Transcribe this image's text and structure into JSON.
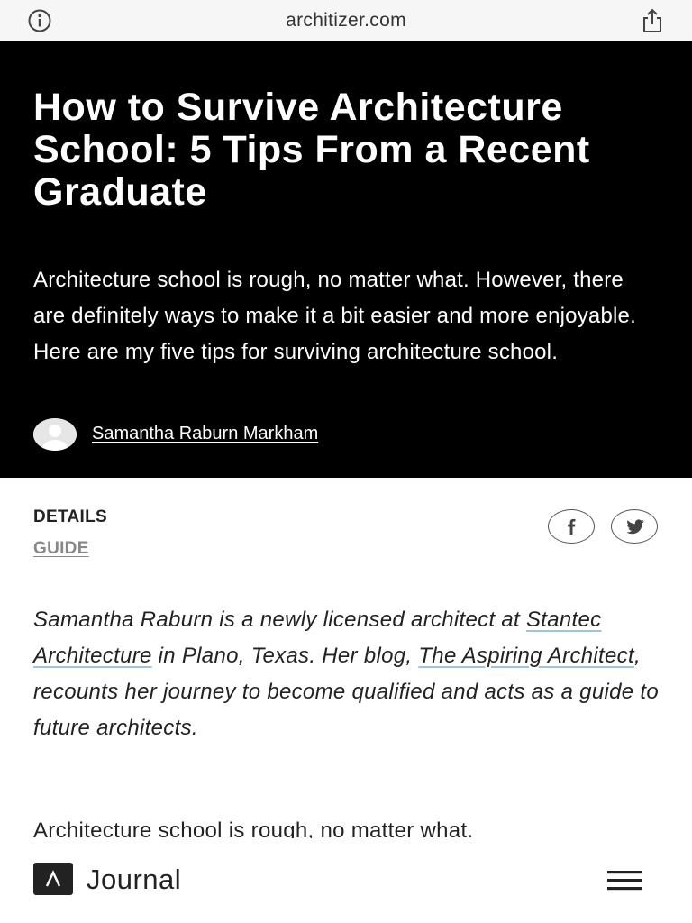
{
  "browser": {
    "domain": "architizer.com",
    "info_icon": "info-icon",
    "share_icon": "share-icon"
  },
  "article": {
    "title": "How to Survive Architecture School: 5 Tips From a Recent Graduate",
    "dek": "Architecture school is rough, no matter what. However, there are definitely ways to make it a bit easier and more enjoyable. Here are my five tips for surviving architecture school.",
    "author": "Samantha Raburn Markham",
    "tags": [
      "DETAILS",
      "GUIDE"
    ],
    "intro": {
      "part1": "Samantha Raburn is a newly licensed architect at ",
      "link1": "Stantec Architecture",
      "part2": " in Plano, Texas. Her blog, ",
      "link2": "The Aspiring Architect",
      "part3": ", recounts her journey to become qualified and acts as a guide to future architects."
    },
    "first_paragraph": "Architecture school is rough, no matter what."
  },
  "social": {
    "facebook_icon": "facebook-icon",
    "twitter_icon": "twitter-icon"
  },
  "footer_nav": {
    "brand": "Journal",
    "logo_icon": "architizer-logo-icon",
    "menu_icon": "hamburger-menu-icon"
  },
  "colors": {
    "hero_bg": "#000000",
    "link_underline": "#9fc4dd",
    "tag_secondary": "#888888"
  }
}
